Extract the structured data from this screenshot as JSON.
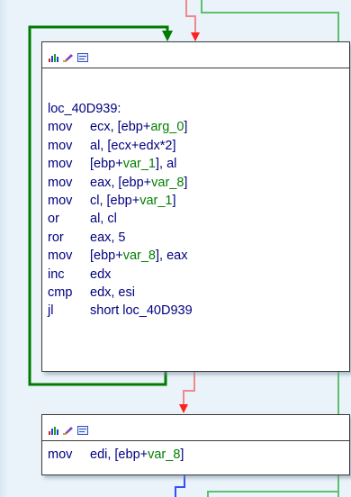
{
  "block1": {
    "toolbar_icons": [
      "graph-icon",
      "edit-icon",
      "list-icon"
    ],
    "lines": [
      {
        "label": "loc_40D939:"
      },
      {
        "mnemonic": "mov",
        "ops": [
          {
            "t": "ecx, [ebp+"
          },
          {
            "t": "arg_0",
            "var": true
          },
          {
            "t": "]"
          }
        ]
      },
      {
        "mnemonic": "mov",
        "ops": [
          {
            "t": "al, [ecx+edx*2]"
          }
        ]
      },
      {
        "mnemonic": "mov",
        "ops": [
          {
            "t": "[ebp+"
          },
          {
            "t": "var_1",
            "var": true
          },
          {
            "t": "], al"
          }
        ]
      },
      {
        "mnemonic": "mov",
        "ops": [
          {
            "t": "eax, [ebp+"
          },
          {
            "t": "var_8",
            "var": true
          },
          {
            "t": "]"
          }
        ]
      },
      {
        "mnemonic": "mov",
        "ops": [
          {
            "t": "cl, [ebp+"
          },
          {
            "t": "var_1",
            "var": true
          },
          {
            "t": "]"
          }
        ]
      },
      {
        "mnemonic": "or",
        "ops": [
          {
            "t": "al, cl"
          }
        ]
      },
      {
        "mnemonic": "ror",
        "ops": [
          {
            "t": "eax, 5"
          }
        ]
      },
      {
        "mnemonic": "mov",
        "ops": [
          {
            "t": "[ebp+"
          },
          {
            "t": "var_8",
            "var": true
          },
          {
            "t": "], eax"
          }
        ]
      },
      {
        "mnemonic": "inc",
        "ops": [
          {
            "t": "edx"
          }
        ]
      },
      {
        "mnemonic": "cmp",
        "ops": [
          {
            "t": "edx, esi"
          }
        ]
      },
      {
        "mnemonic": "jl",
        "ops": [
          {
            "t": "short loc_40D939"
          }
        ]
      }
    ]
  },
  "block2": {
    "toolbar_icons": [
      "graph-icon",
      "edit-icon",
      "list-icon"
    ],
    "lines": [
      {
        "mnemonic": "mov",
        "ops": [
          {
            "t": "edi, [ebp+"
          },
          {
            "t": "var_8",
            "var": true
          },
          {
            "t": "]"
          }
        ]
      }
    ]
  },
  "colors": {
    "true_edge": "#007a00",
    "false_edge": "#ff2020",
    "false_edge_light": "#f08a8a",
    "green_edge_light": "#5fbf6f",
    "blue_edge": "#3050ff",
    "code_text": "#000080",
    "var_text": "#008000",
    "background": "#e9f3f9"
  }
}
